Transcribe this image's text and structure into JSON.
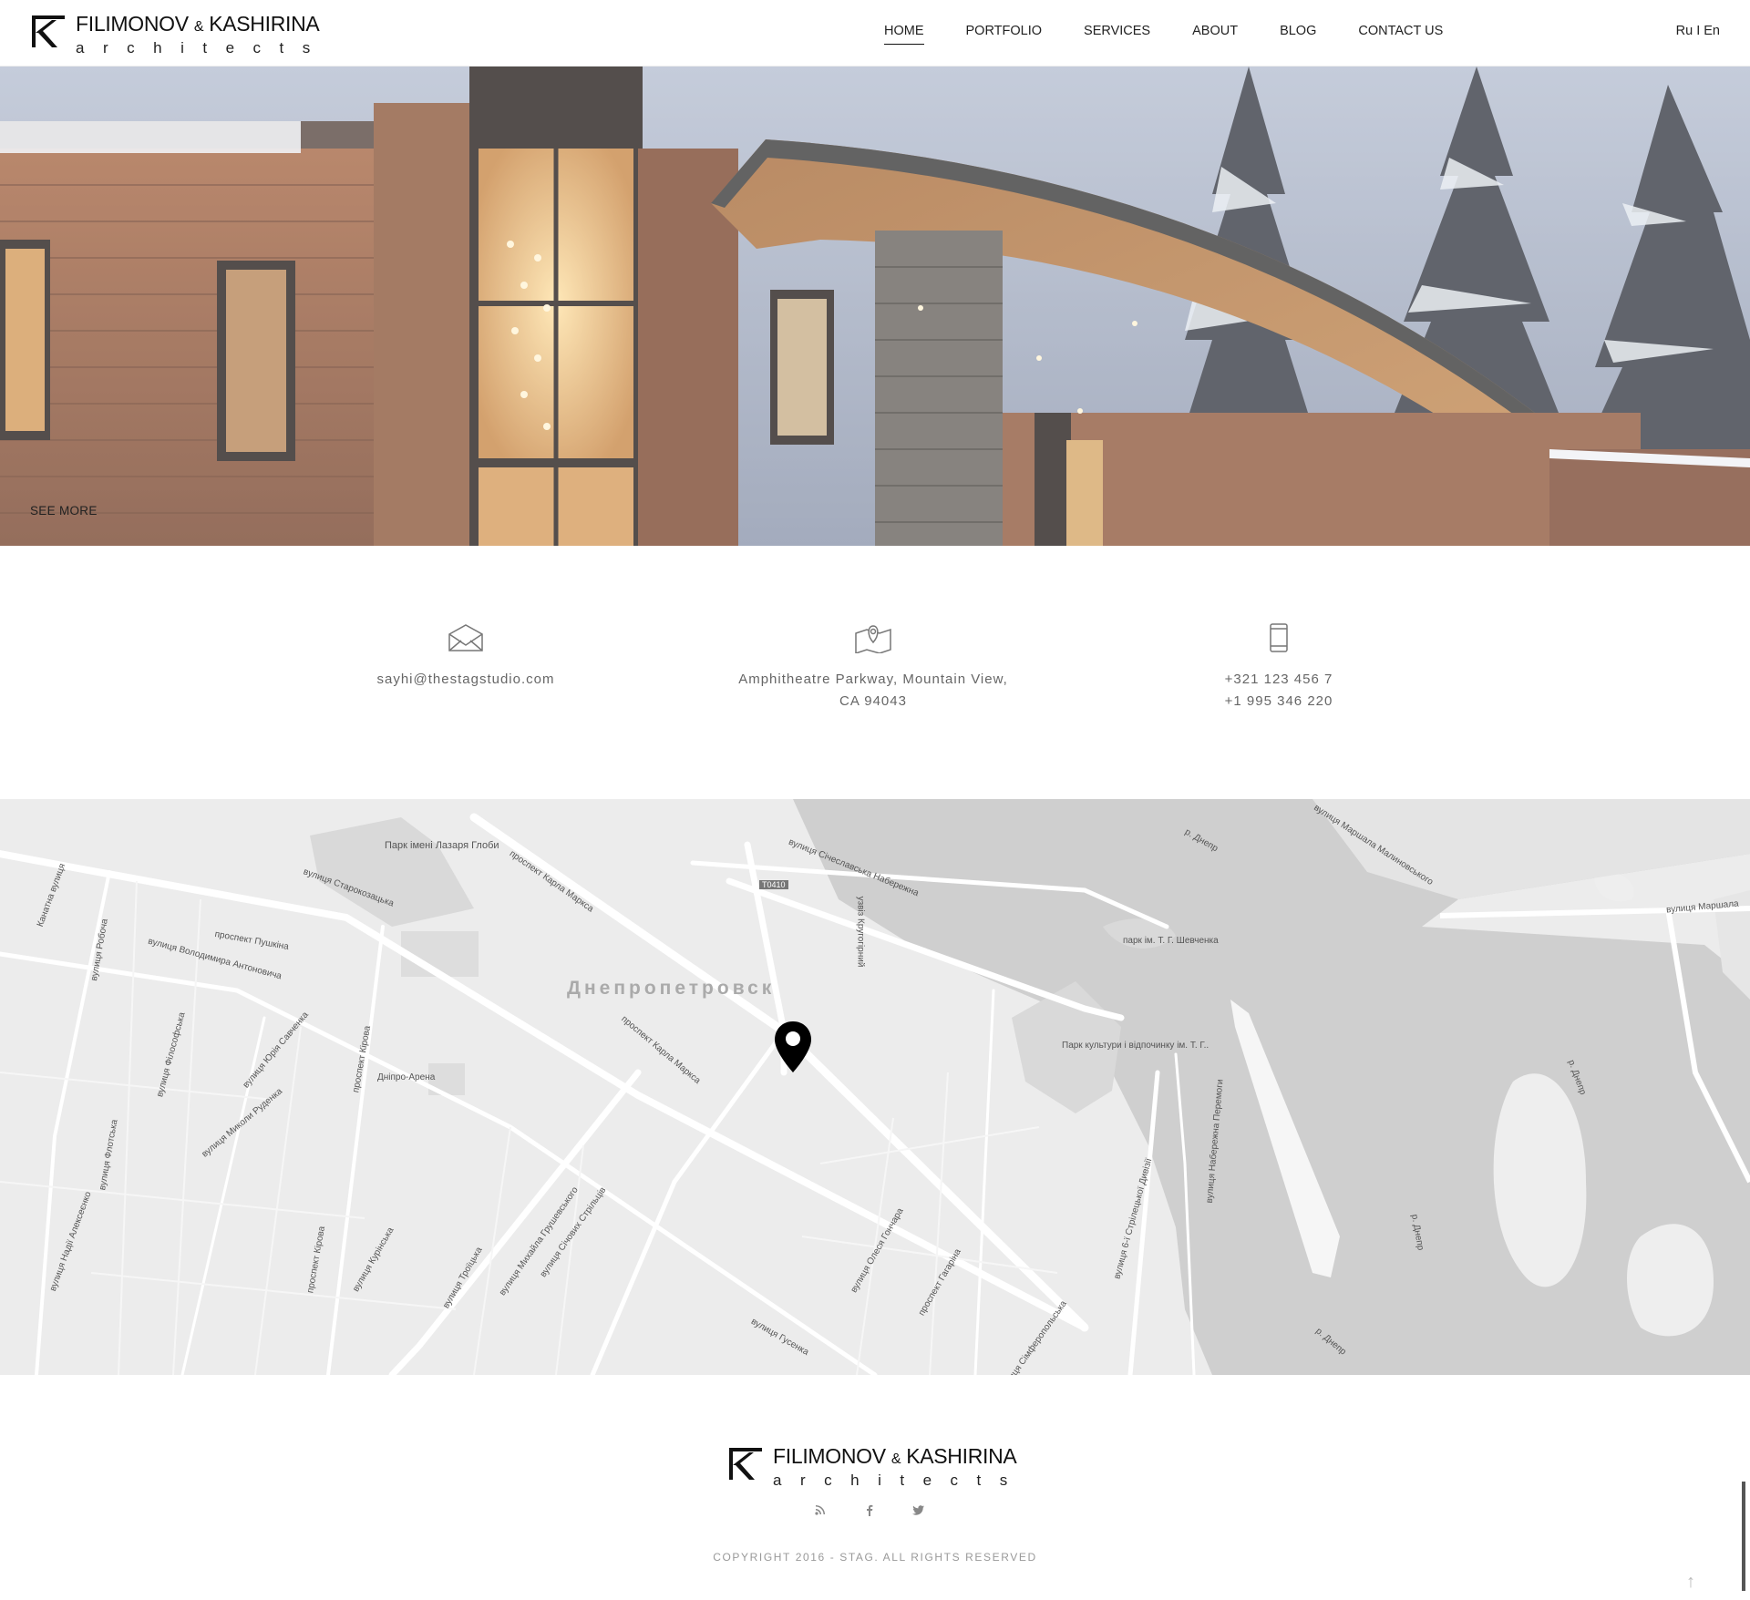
{
  "brand": {
    "name_part1": "FILIMONOV",
    "ampersand": "&",
    "name_part2": "KASHIRINA",
    "tagline": "architects"
  },
  "nav": {
    "items": [
      "HOME",
      "PORTFOLIO",
      "SERVICES",
      "ABOUT",
      "BLOG",
      "CONTACT US"
    ],
    "active": "HOME"
  },
  "lang": {
    "label": "Ru I En"
  },
  "hero": {
    "see_more": "SEE MORE"
  },
  "contacts": {
    "email": "sayhi@thestagstudio.com",
    "address_line1": "Amphitheatre Parkway, Mountain View,",
    "address_line2": "CA 94043",
    "phone1": "+321 123 456 7",
    "phone2": "+1 995 346 220",
    "icons": [
      "envelope-icon",
      "map-location-icon",
      "mobile-phone-icon"
    ]
  },
  "map": {
    "city": "Днепропетровск",
    "labels": {
      "park_lazarya": "Парк імені Лазаря Глоби",
      "starokozatska": "вулиця Старокозацька",
      "karla_marksa_1": "проспект Карла Маркса",
      "karla_marksa_2": "проспект Карла Маркса",
      "pushkina": "проспект Пушкіна",
      "volodymyra": "вулиця Володимира Антоновича",
      "dnipro_arena": "Дніпро-Арена",
      "sichoslavska": "вулиця Січеславська Набережна",
      "road": "T0410",
      "dnepr_1": "р. Днепр",
      "dnepr_2": "р. Днепр",
      "dnepr_3": "р. Днепр",
      "dnepr_4": "р. Днепр",
      "shevchenko_park": "парк ім. Т. Г. Шевченка",
      "park_kultury": "Парк культури і відпочинку ім. Т. Г..",
      "marshala": "вулиця Маршала Малиновського",
      "marshala_2": "вулиця Маршала",
      "gonchara": "вулиця Олеся Гончара",
      "gagarina": "проспект Гагаріна",
      "gusenka": "вулиця Гусенка",
      "kirova": "проспект Кірова",
      "kirova_2": "проспект Кірова",
      "troitska": "вулиця Троїцька",
      "grushevskogo": "вулиця Михайла Грушевського",
      "sichovyh": "вулиця Січових Стрільців",
      "kurinska": "вулиця Курінська",
      "rudenka": "вулиця Миколи Руденка",
      "alekseenko": "вулиця Надії Алексеєнко",
      "kruhohirnyi": "узвіз Кругогірний",
      "strilets": "вулиця 6-ї Стрілецької Дивізії",
      "naberezhna_peremohy": "вулиця Набережна Перемоги",
      "simferopolska": "вулиця Сімферопольська",
      "robocha": "вулиця Робоча",
      "filosofska": "вулиця Філософська",
      "savchenka": "вулиця Юрія Савченка",
      "flotska": "вулиця Флотська",
      "kanatna": "Канатна вулиця"
    }
  },
  "footer": {
    "copyright": "COPYRIGHT 2016 - STAG. ALL RIGHTS RESERVED",
    "social": [
      "rss-icon",
      "facebook-icon",
      "twitter-icon"
    ]
  },
  "colors": {
    "accent": "#111111",
    "muted": "#999999",
    "map_land": "#ececec",
    "map_water": "#cfcfcf"
  }
}
